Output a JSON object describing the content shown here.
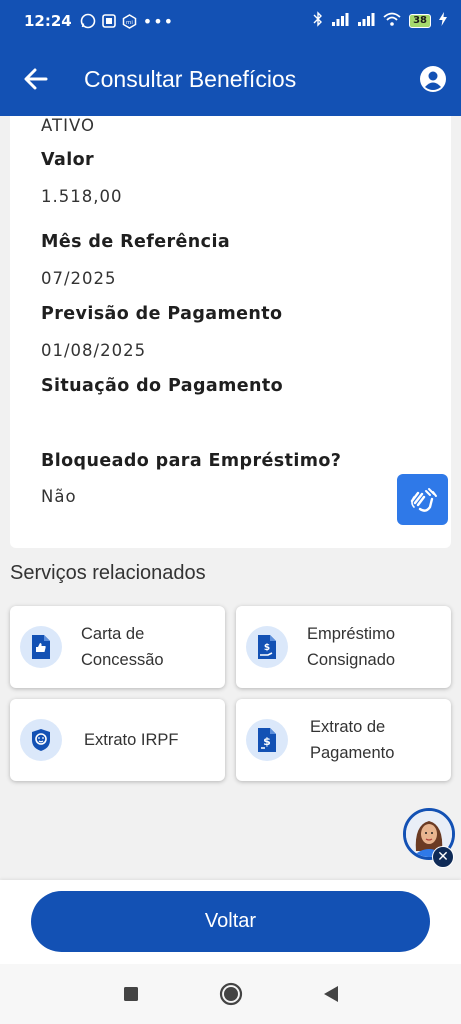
{
  "status_bar": {
    "time": "12:24",
    "battery": "38"
  },
  "app_bar": {
    "title": "Consultar Benefícios"
  },
  "details": [
    {
      "label": "",
      "value": "ATIVO"
    },
    {
      "label": "Valor",
      "value": "1.518,00"
    },
    {
      "label": "Mês de Referência",
      "value": "07/2025"
    },
    {
      "label": "Previsão de Pagamento",
      "value": "01/08/2025"
    },
    {
      "label": "Situação do Pagamento",
      "value": ""
    },
    {
      "label": "Bloqueado para Empréstimo?",
      "value": "Não"
    }
  ],
  "services": {
    "title": "Serviços relacionados",
    "items": [
      {
        "label": "Carta de\nConcessão",
        "icon": "document-thumbs-up-icon"
      },
      {
        "label": "Empréstimo\nConsignado",
        "icon": "document-money-hand-icon"
      },
      {
        "label": "Extrato IRPF",
        "icon": "lion-shield-icon"
      },
      {
        "label": "Extrato de\nPagamento",
        "icon": "document-dollar-icon"
      }
    ]
  },
  "footer": {
    "back_label": "Voltar"
  },
  "colors": {
    "primary": "#1351b4",
    "accessibility_button": "#2f79e8",
    "icon_circle": "#dbe8fa"
  }
}
